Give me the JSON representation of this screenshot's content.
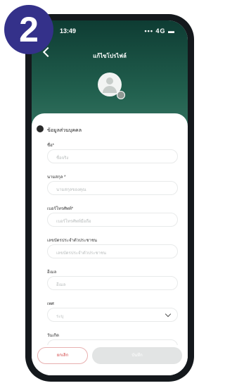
{
  "step_badge": "2",
  "status_bar": {
    "time": "13:49",
    "icons": "••• 4G ▬"
  },
  "header": {
    "title": "แก้ไขโปรไฟล์"
  },
  "section": {
    "title": "ข้อมูลส่วนบุคคล"
  },
  "fields": [
    {
      "label": "ชื่อ*",
      "placeholder": "ชื่อจริง"
    },
    {
      "label": "นามสกุล *",
      "placeholder": "นามสกุลของคุณ"
    },
    {
      "label": "เบอร์โทรศัพท์*",
      "placeholder": "เบอร์โทรศัพท์มือถือ"
    },
    {
      "label": "เลขบัตรประจำตัวประชาชน",
      "placeholder": "เลขบัตรประจำตัวประชาชน"
    },
    {
      "label": "อีเมล",
      "placeholder": "อีเมล"
    },
    {
      "label": "เพศ",
      "placeholder": "ระบุ"
    },
    {
      "label": "วันเกิด",
      "placeholder": ""
    }
  ],
  "footer": {
    "cancel_label": "ยกเลิก",
    "save_label": "บันทึก"
  }
}
